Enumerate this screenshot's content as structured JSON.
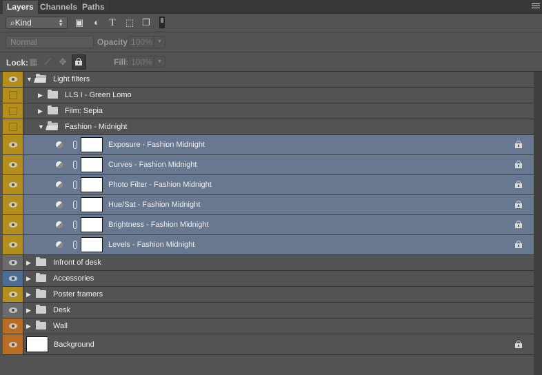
{
  "tabs": [
    {
      "label": "Layers",
      "active": true
    },
    {
      "label": "Channels",
      "active": false
    },
    {
      "label": "Paths",
      "active": false
    }
  ],
  "filter": {
    "kind_label": "Kind",
    "icons": [
      "image-filter-icon",
      "adjustment-filter-icon",
      "type-filter-icon",
      "shape-filter-icon",
      "smart-object-filter-icon"
    ],
    "type_glyph": "T"
  },
  "blend": {
    "mode": "Normal",
    "opacity_label": "Opacity:",
    "opacity_value": "100%"
  },
  "lock": {
    "label": "Lock:",
    "fill_label": "Fill:",
    "fill_value": "100%"
  },
  "colors": {
    "yellow": "#b38e1d",
    "gray": "#6b6b6b",
    "blue": "#4c6e96",
    "orange": "#b96d22",
    "selected": "#687890"
  },
  "layers": [
    {
      "name": "Light filters",
      "type": "group",
      "open": true,
      "indent": 0,
      "visible": true,
      "color": "yellow"
    },
    {
      "name": "LLS I - Green Lomo",
      "type": "group",
      "open": false,
      "indent": 1,
      "visible": false,
      "color": "yellow"
    },
    {
      "name": "Film: Sepia",
      "type": "group",
      "open": false,
      "indent": 1,
      "visible": false,
      "color": "yellow"
    },
    {
      "name": "Fashion - Midnight",
      "type": "group",
      "open": true,
      "indent": 1,
      "visible": false,
      "color": "yellow"
    },
    {
      "name": "Exposure - Fashion Midnight",
      "type": "adjustment",
      "selected": true,
      "locked": true,
      "visible": true,
      "color": "yellow"
    },
    {
      "name": "Curves - Fashion Midnight",
      "type": "adjustment",
      "selected": true,
      "locked": true,
      "visible": true,
      "color": "yellow"
    },
    {
      "name": "Photo Filter - Fashion Midnight",
      "type": "adjustment",
      "selected": true,
      "locked": true,
      "visible": true,
      "color": "yellow"
    },
    {
      "name": "Hue/Sat - Fashion Midnight",
      "type": "adjustment",
      "selected": true,
      "locked": true,
      "visible": true,
      "color": "yellow"
    },
    {
      "name": "Brightness - Fashion Midnight",
      "type": "adjustment",
      "selected": true,
      "locked": true,
      "visible": true,
      "color": "yellow"
    },
    {
      "name": "Levels - Fashion Midnight",
      "type": "adjustment",
      "selected": true,
      "locked": true,
      "visible": true,
      "color": "yellow"
    },
    {
      "name": "Infront of desk",
      "type": "group",
      "open": false,
      "indent": 0,
      "visible": true,
      "color": "gray"
    },
    {
      "name": "Accessories",
      "type": "group",
      "open": false,
      "indent": 0,
      "visible": true,
      "color": "blue"
    },
    {
      "name": "Poster framers",
      "type": "group",
      "open": false,
      "indent": 0,
      "visible": true,
      "color": "yellow"
    },
    {
      "name": "Desk",
      "type": "group",
      "open": false,
      "indent": 0,
      "visible": true,
      "color": "gray"
    },
    {
      "name": "Wall",
      "type": "group",
      "open": false,
      "indent": 0,
      "visible": true,
      "color": "orange"
    },
    {
      "name": "Background",
      "type": "background",
      "locked": true,
      "visible": true,
      "color": "orange"
    }
  ]
}
